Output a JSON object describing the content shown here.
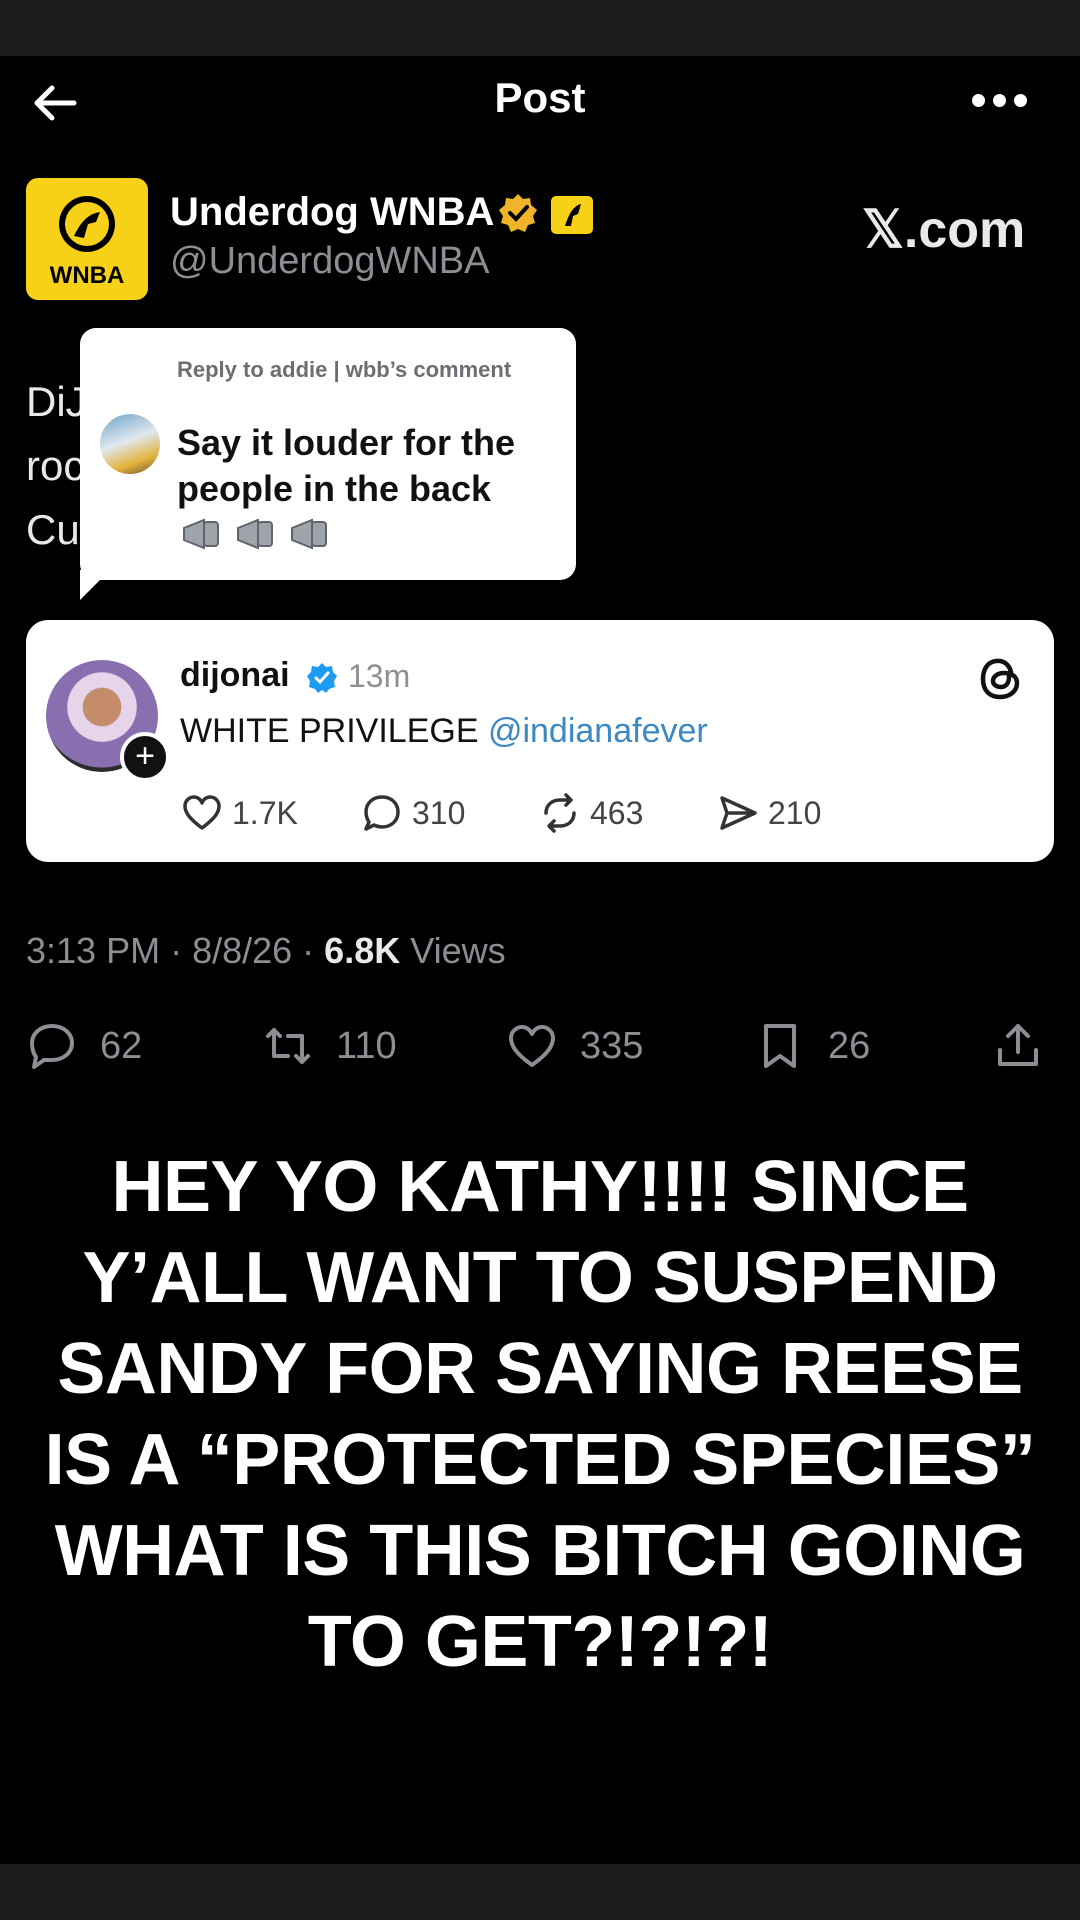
{
  "nav": {
    "title": "Post"
  },
  "author": {
    "name": "Underdog WNBA",
    "handle": "@UnderdogWNBA",
    "logo_text": "WNBA",
    "watermark": "𝕏.com"
  },
  "tweet": {
    "text": "DiJ                               eads from the locker\nroc                               r foul on Sophie\nCu"
  },
  "reply_overlay": {
    "label": "Reply to addie | wbb’s comment",
    "text": "Say it louder for the people in the back",
    "emoji_icon": "megaphone-icon"
  },
  "threads_post": {
    "username": "dijonai",
    "time": "13m",
    "body": "WHITE PRIVILEGE ",
    "mention": "@indianafever",
    "likes": "1.7K",
    "comments": "310",
    "reposts": "463",
    "shares": "210"
  },
  "meta": {
    "time": "3:13 PM",
    "date": "8/8/26",
    "views": "6.8K",
    "views_label": "Views",
    "sep": " · "
  },
  "actions": {
    "replies": "62",
    "reposts": "110",
    "likes": "335",
    "bookmarks": "26"
  },
  "caption": "HEY YO KATHY!!!! SINCE Y’ALL WANT TO SUSPEND SANDY FOR SAYING REESE IS A “PROTECTED SPECIES” WHAT IS THIS BITCH GOING TO GET?!?!?!",
  "colors": {
    "background": "#000000",
    "link": "#3b88c3",
    "gold_badge": "#f0b429",
    "brand_yellow": "#f7d117"
  }
}
